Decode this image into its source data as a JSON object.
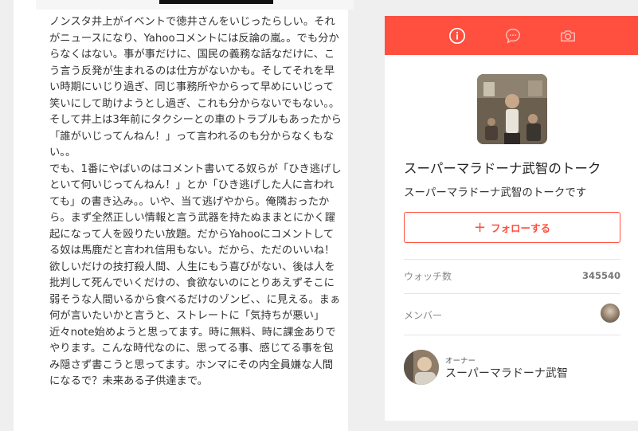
{
  "post": {
    "body": "ノンスタ井上がイベントで徳井さんをいじったらしい。それがニュースになり、Yahooコメントには反論の嵐。。でも分からなくはない。事が事だけに、国民の義務な話なだけに、こう言う反発が生まれるのは仕方がないかも。そしてそれを早い時期にいじり過ぎ、同じ事務所やからって早めにいじって笑いにして助けようとし過ぎ、これも分からないでもない。。そして井上は3年前にタクシーとの車のトラブルもあったから「誰がいじってんねん！」って言われるのも分からなくもない。。\nでも、1番にやばいのはコメント書いてる奴らが「ひき逃げしといて何いじってんねん！」とか「ひき逃げした人に言われても」の書き込み。。いや、当て逃げやから。俺隣おったから。まず全然正しい情報と言う武器を持たぬままとにかく躍起になって人を殴りたい放題。だからYahooにコメントしてる奴は馬鹿だと言われ信用もない。だから、ただのいいね！欲しいだけの技打殺人間、人生にもう喜びがない、後は人を批判して死んでいくだけの、食欲ないのにとりあえずそこに弱そうな人間いるから食べるだけのゾンビ、、に見える。まぁ何が言いたいかと言うと、ストレートに「気持ちが悪い」近々note始めようと思ってます。時に無料、時に課金ありでやります。こんな時代なのに、思ってる事、感じてる事を包み隠さず書こうと思ってます。ホンマにその内全員嫌な人間になるで？未来ある子供達まで。"
  },
  "sidebar": {
    "accent_color": "#ff4f3f",
    "tabs": [
      {
        "icon": "info-icon",
        "active": true
      },
      {
        "icon": "chat-bubble-icon",
        "active": false
      },
      {
        "icon": "camera-icon",
        "active": false
      }
    ],
    "talk_title": "スーパーマラドーナ武智のトーク",
    "talk_description": "スーパーマラドーナ武智のトークです",
    "follow_label": "フォローする",
    "watch_label": "ウォッチ数",
    "watch_count": "345540",
    "members_label": "メンバー",
    "owner_role": "オーナー",
    "owner_name": "スーパーマラドーナ武智"
  }
}
